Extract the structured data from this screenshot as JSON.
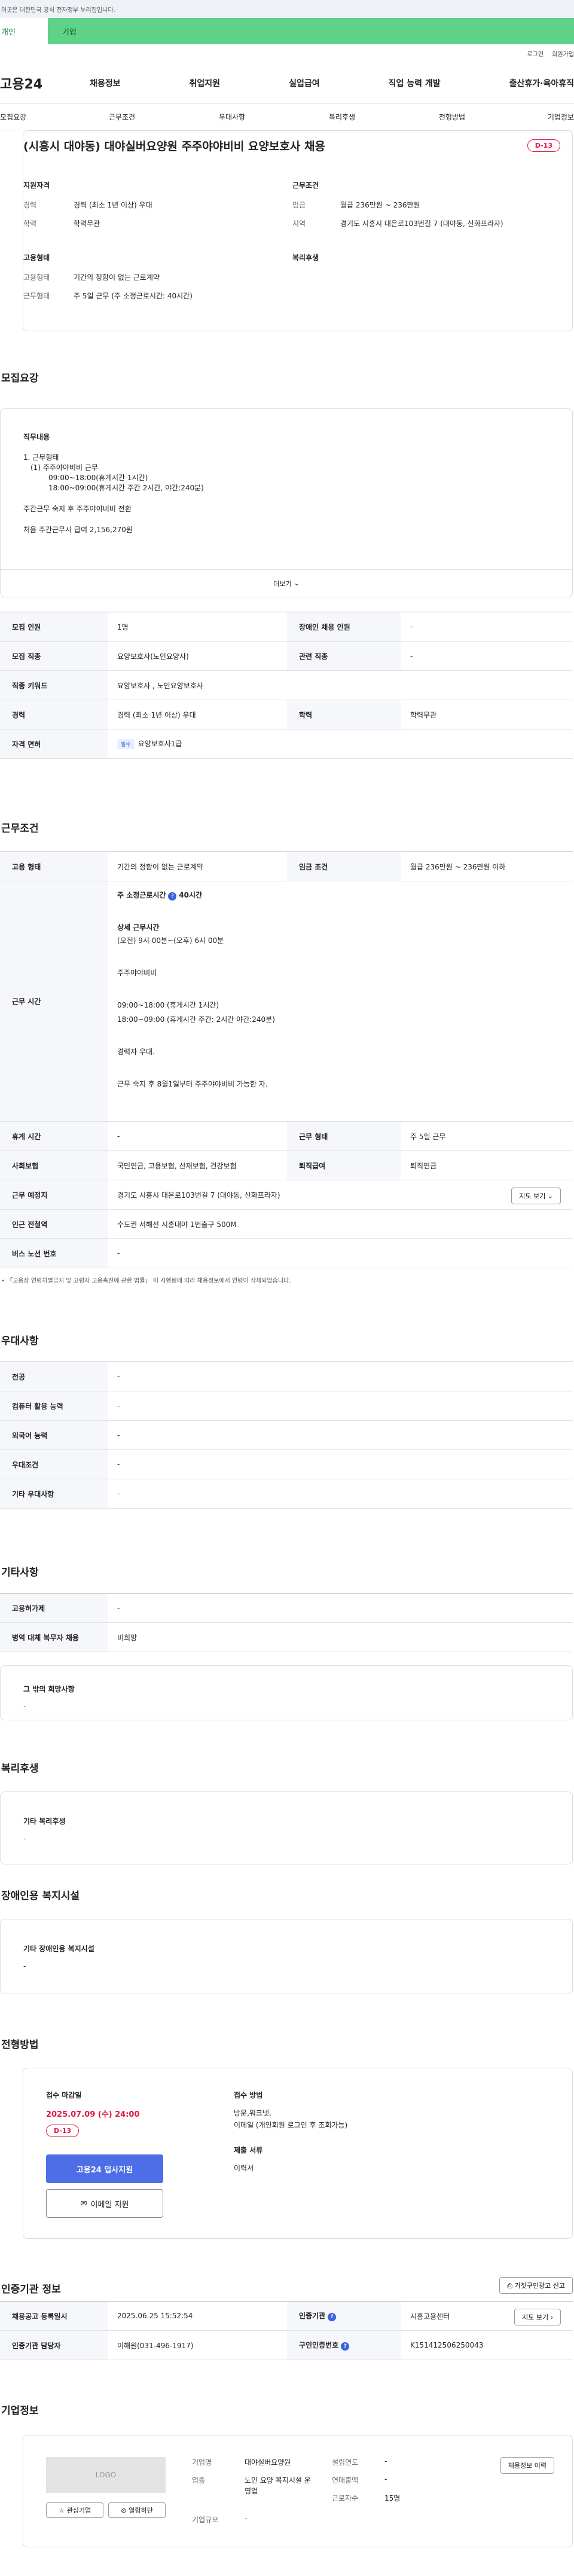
{
  "notice": "이곳은 대한민국 공식 전자정부 누리집입니다.",
  "user_tabs": {
    "personal": "개인",
    "company": "기업"
  },
  "util": {
    "login": "로그인",
    "join": "회원가입"
  },
  "site_logo": "고용24",
  "gnb": [
    "채용정보",
    "취업지원",
    "실업급여",
    "직업 능력 개발",
    "출산휴가·육아휴직"
  ],
  "sub_tabs": [
    "모집요강",
    "근무조건",
    "우대사항",
    "복리후생",
    "전형방법",
    "기업정보"
  ],
  "job": {
    "title": "(시흥시 대야동) 대야실버요양원 주주야야비비 요양보호사 채용",
    "dday": "D-13"
  },
  "summary": {
    "qualification_title": "지원자격",
    "career_label": "경력",
    "career_value": "경력 (최소 1년 이상) 우대",
    "education_label": "학력",
    "education_value": "학력무관",
    "employment_title": "고용형태",
    "emp_type_label": "고용형태",
    "emp_type_value": "기간의 정함이 없는 근로계약",
    "work_type_label": "근무형태",
    "work_type_value": "주 5일 근무 (주 소정근로시간: 40시간)",
    "conditions_title": "근무조건",
    "wage_label": "임금",
    "wage_value": "월급 236만원 ~ 236만원",
    "region_label": "지역",
    "region_value": "경기도 시흥시 대은로103번길 7 (대야동, 신화프라자)",
    "welfare_title": "복리후생"
  },
  "recruit": {
    "section_title": "모집요강",
    "duty_title": "직무내용",
    "duty_lines": [
      "1. 근무형태",
      "(1) 주주야야비비 근무",
      "09:00~18:00(휴게시간 1시간)",
      "18:00~09:00(휴게시간 주간 2시간, 야간:240분)",
      "주간근무 숙지 후 주주야야비비 전환",
      "처음 주간근무시 급여 2,156,270원"
    ],
    "more_label": "더보기",
    "table": [
      [
        "모집 인원",
        "1명",
        "장애인 채용 인원",
        "-"
      ],
      [
        "모집 직종",
        "요양보호사(노인요양사)",
        "관련 직종",
        "-"
      ],
      [
        "직종 키워드",
        "요양보호사 , 노인요양보호사",
        "",
        ""
      ],
      [
        "경력",
        "경력 (최소 1년 이상) 우대",
        "학력",
        "학력무관"
      ]
    ],
    "license_label": "자격 면허",
    "license_badge": "필수",
    "license_value": "요양보호사1급"
  },
  "conditions": {
    "section_title": "근무조건",
    "emp_type_label": "고용 형태",
    "emp_type_value": "기간의 정함이 없는 근로계약",
    "wage_label": "임금 조건",
    "wage_value": "월급 236만원 ~ 236만원 이하",
    "hours_label": "근무 시간",
    "hours_weekly": "주 소정근로시간",
    "hours_weekly_value": "40시간",
    "hours_lines": [
      "상세 근무시간",
      "(오전) 9시 00분~(오후) 6시 00분",
      "주주야야비비",
      "09:00~18:00 (휴게시간 1시간)",
      "18:00~09:00 (휴게시간 주간: 2시간 야간:240분)",
      "경력자 우대.",
      "근무 숙지 후 8월1일부터 주주야야비비 가능한 자."
    ],
    "rest_label": "휴게 시간",
    "rest_value": "-",
    "work_form_label": "근무 형태",
    "work_form_value": "주 5일 근무",
    "insurance_label": "사회보험",
    "insurance_value": "국민연금, 고용보험, 산재보험, 건강보험",
    "retire_label": "퇴직급여",
    "retire_value": "퇴직연금",
    "place_label": "근무 예정지",
    "place_value": "경기도 시흥시 대은로103번길 7 (대야동, 신화프라자)",
    "map_label": "지도 보기",
    "subway_label": "인근 전철역",
    "subway_value": "수도권 서해선 시흥대야 1번출구 500M",
    "bus_label": "버스 노선 번호",
    "bus_value": "-",
    "note": "「고용상 연령차별금지 및 고령자 고용촉진에 관한 법률」 이 시행됨에 따라 채용정보에서 연령이 삭제되었습니다."
  },
  "preference": {
    "section_title": "우대사항",
    "rows": [
      [
        "전공",
        "-"
      ],
      [
        "컴퓨터 활용 능력",
        "-"
      ],
      [
        "외국어 능력",
        "-"
      ],
      [
        "우대조건",
        "-"
      ],
      [
        "기타 우대사항",
        "-"
      ]
    ]
  },
  "others": {
    "section_title": "기타사항",
    "rows": [
      [
        "고용허가제",
        "-"
      ],
      [
        "병역 대체 복무자 채용",
        "비희망"
      ]
    ],
    "wish_title": "그 밖의 희망사항",
    "wish_value": "-"
  },
  "welfare": {
    "section_title": "복리후생",
    "box_title": "기타 복리후생",
    "box_value": "-"
  },
  "disability": {
    "section_title": "장애인용 복지시설",
    "box_title": "기타 장애인용 복지시설",
    "box_value": "-"
  },
  "process": {
    "section_title": "전형방법",
    "deadline_label": "접수 마감일",
    "deadline_value": "2025.07.09 (수) 24:00",
    "dday": "D-13",
    "apply_button": "고용24 입사지원",
    "email_button": "이메일 지원",
    "method_label": "접수 방법",
    "method_value": "방문,워크넷,",
    "method_value2": "이메일 (개인회원 로그인 후 조회가능)",
    "docs_label": "제출 서류",
    "docs_value": "이력서"
  },
  "agency": {
    "section_title": "인증기관 정보",
    "print_button": "거짓구인광고 신고",
    "reg_date_label": "채용공고 등록일시",
    "reg_date_value": "2025.06.25 15:52:54",
    "agency_label": "인증기관",
    "agency_value": "시흥고용센터",
    "map_label": "지도 보기",
    "manager_label": "인증기관 담당자",
    "manager_value": "이해원(031-496-1917)",
    "job_no_label": "구인인증번호",
    "job_no_value": "K151412506250043"
  },
  "company": {
    "section_title": "기업정보",
    "logo_text": "LOGO",
    "fav_button": "관심기업",
    "block_button": "열람하단",
    "name_label": "기업명",
    "name_value": "대야실버요양원",
    "industry_label": "업종",
    "industry_value": "노인 요양 복지시설 운영업",
    "size_label": "기업규모",
    "size_value": "-",
    "founded_label": "설립연도",
    "founded_value": "-",
    "sales_label": "연매출액",
    "sales_value": "-",
    "employees_label": "근로자수",
    "employees_value": "15명",
    "history_button": "채용정보 이력"
  }
}
